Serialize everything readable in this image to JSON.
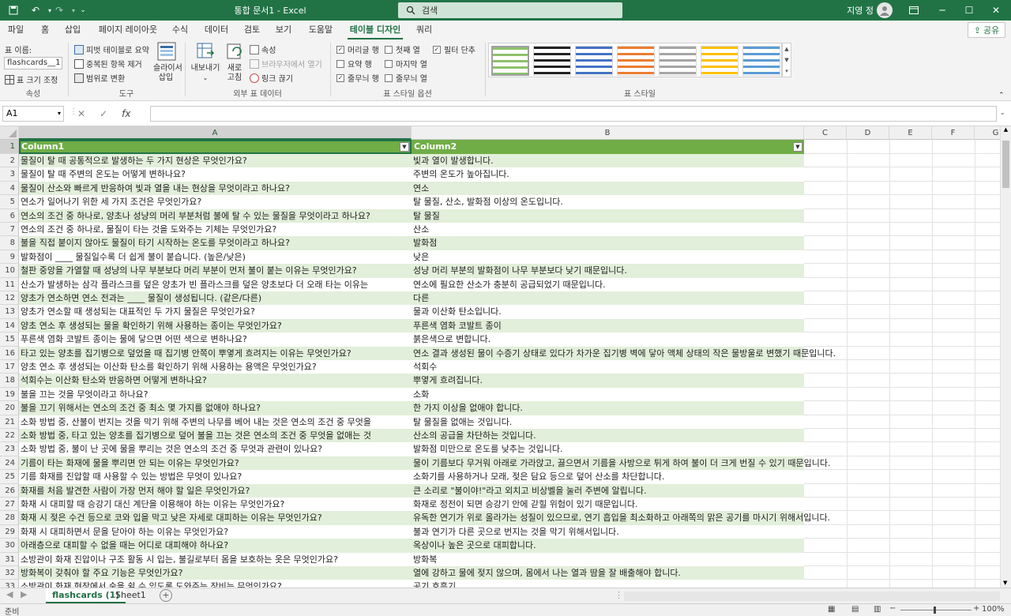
{
  "window": {
    "title": "통합 문서1  -  Excel",
    "user": "지영 정"
  },
  "search": {
    "placeholder": "검색"
  },
  "tabs": [
    {
      "label": "파일"
    },
    {
      "label": "홈"
    },
    {
      "label": "삽입"
    },
    {
      "label": "페이지 레이아웃"
    },
    {
      "label": "수식"
    },
    {
      "label": "데이터"
    },
    {
      "label": "검토"
    },
    {
      "label": "보기"
    },
    {
      "label": "도움말"
    },
    {
      "label": "테이블 디자인"
    },
    {
      "label": "쿼리"
    }
  ],
  "share_label": "공유",
  "ribbon": {
    "props": {
      "name_label": "표 이름:",
      "name_value": "flashcards__1",
      "resize": "표 크기 조정",
      "group": "속성"
    },
    "tools": {
      "pivot": "피벗 테이블로 요약",
      "dedupe": "중복된 항목 제거",
      "convert": "범위로 변환",
      "slicer": "슬라이서 삽입",
      "group": "도구"
    },
    "external": {
      "export": "내보내기",
      "refresh": "새로 고침",
      "properties": "속성",
      "open_browser": "브라우저에서 열기",
      "unlink": "링크 끊기",
      "group": "외부 표 데이터"
    },
    "options": {
      "header_row": "머리글 행",
      "total_row": "요약 행",
      "banded_rows": "줄무늬 행",
      "first_col": "첫째 열",
      "last_col": "마지막 열",
      "banded_cols": "줄무늬 열",
      "filter_btn": "필터 단추",
      "group": "표 스타일 옵션"
    },
    "styles": {
      "group": "표 스타일"
    }
  },
  "formula": {
    "cell_ref": "A1",
    "value": ""
  },
  "columns": [
    "A",
    "B",
    "C",
    "D",
    "E",
    "F",
    "G"
  ],
  "table": {
    "headers": [
      "Column1",
      "Column2"
    ],
    "rows": [
      [
        "물질이 탈 때 공통적으로 발생하는 두 가지 현상은 무엇인가요?",
        "빛과 열이 발생합니다."
      ],
      [
        "물질이 탈 때 주변의 온도는 어떻게 변하나요?",
        "주변의 온도가 높아집니다."
      ],
      [
        "물질이 산소와 빠르게 반응하여 빛과 열을 내는 현상을 무엇이라고 하나요?",
        "연소"
      ],
      [
        "연소가 일어나기 위한 세 가지 조건은 무엇인가요?",
        "탈 물질, 산소, 발화점 이상의 온도입니다."
      ],
      [
        "연소의 조건 중 하나로, 양초나 성냥의 머리 부분처럼 불에 탈 수 있는 물질을 무엇이라고 하나요?",
        "탈 물질"
      ],
      [
        "연소의 조건 중 하나로, 물질이 타는 것을 도와주는 기체는 무엇인가요?",
        "산소"
      ],
      [
        "불을 직접 붙이지 않아도 물질이 타기 시작하는 온도를 무엇이라고 하나요?",
        "발화점"
      ],
      [
        "발화점이 ____ 물질일수록 더 쉽게 불이 붙습니다. (높은/낮은)",
        "낮은"
      ],
      [
        "철판 중앙을 가열할 때 성냥의 나무 부분보다 머리 부분이 먼저 불이 붙는 이유는 무엇인가요?",
        "성냥 머리 부분의 발화점이 나무 부분보다 낮기 때문입니다."
      ],
      [
        "산소가 발생하는 삼각 플라스크를 덮은 양초가 빈 플라스크를 덮은 양초보다 더 오래 타는 이유는",
        "연소에 필요한 산소가 충분히 공급되었기 때문입니다."
      ],
      [
        "양초가 연소하면 연소 전과는 ____ 물질이 생성됩니다. (같은/다른)",
        "다른"
      ],
      [
        "양초가 연소할 때 생성되는 대표적인 두 가지 물질은 무엇인가요?",
        "물과 이산화 탄소입니다."
      ],
      [
        "양초 연소 후 생성되는 물을 확인하기 위해 사용하는 종이는 무엇인가요?",
        "푸른색 염화 코발트 종이"
      ],
      [
        "푸른색 염화 코발트 종이는 물에 닿으면 어떤 색으로 변하나요?",
        "붉은색으로 변합니다."
      ],
      [
        "타고 있는 양초를 집기병으로 덮었을 때 집기병 안쪽이 뿌옇게 흐려지는 이유는 무엇인가요?",
        "연소 결과 생성된 물이 수증기 상태로 있다가 차가운 집기병 벽에 닿아 액체 상태의 작은 물방울로 변했기 때문입니다."
      ],
      [
        "양초 연소 후 생성되는 이산화 탄소를 확인하기 위해 사용하는 용액은 무엇인가요?",
        "석회수"
      ],
      [
        "석회수는 이산화 탄소와 반응하면 어떻게 변하나요?",
        "뿌옇게 흐려집니다."
      ],
      [
        "불을 끄는 것을 무엇이라고 하나요?",
        "소화"
      ],
      [
        "불을 끄기 위해서는 연소의 조건 중 최소 몇 가지를 없애야 하나요?",
        "한 가지 이상을 없애야 합니다."
      ],
      [
        "소화 방법 중, 산불이 번지는 것을 막기 위해 주변의 나무를 베어 내는 것은 연소의 조건 중 무엇을",
        "탈 물질을 없애는 것입니다."
      ],
      [
        "소화 방법 중, 타고 있는 양초를 집기병으로 덮어 불을 끄는 것은 연소의 조건 중 무엇을 없애는 것",
        "산소의 공급을 차단하는 것입니다."
      ],
      [
        "소화 방법 중, 불이 난 곳에 물을 뿌리는 것은 연소의 조건 중 무엇과 관련이 있나요?",
        "발화점 미만으로 온도를 낮추는 것입니다."
      ],
      [
        "기름이 타는 화재에 물을 뿌리면 안 되는 이유는 무엇인가요?",
        "물이 기름보다 무거워 아래로 가라앉고, 끓으면서 기름을 사방으로 튀게 하여 불이 더 크게 번질 수 있기 때문입니다."
      ],
      [
        "기름 화재를 진압할 때 사용할 수 있는 방법은 무엇이 있나요?",
        "소화기를 사용하거나 모래, 젖은 담요 등으로 덮어 산소를 차단합니다."
      ],
      [
        "화재를 처음 발견한 사람이 가장 먼저 해야 할 일은 무엇인가요?",
        "큰 소리로 \"불이야!\"라고 외치고 비상벨을 눌러 주변에 알립니다."
      ],
      [
        "화재 시 대피할 때 승강기 대신 계단을 이용해야 하는 이유는 무엇인가요?",
        "화재로 정전이 되면 승강기 안에 갇힐 위험이 있기 때문입니다."
      ],
      [
        "화재 시 젖은 수건 등으로 코와 입을 막고 낮은 자세로 대피하는 이유는 무엇인가요?",
        "유독한 연기가 위로 올라가는 성질이 있으므로, 연기 흡입을 최소화하고 아래쪽의 맑은 공기를 마시기 위해서입니다."
      ],
      [
        "화재 시 대피하면서 문을 닫아야 하는 이유는 무엇인가요?",
        "불과 연기가 다른 곳으로 번지는 것을 막기 위해서입니다."
      ],
      [
        "아래층으로 대피할 수 없을 때는 어디로 대피해야 하나요?",
        "옥상이나 높은 곳으로 대피합니다."
      ],
      [
        "소방관이 화재 진압이나 구조 활동 시 입는, 불길로부터 몸을 보호하는 옷은 무엇인가요?",
        "방화복"
      ],
      [
        "방화복이 갖춰야 할 주요 기능은 무엇인가요?",
        "열에 강하고 물에 젖지 않으며, 몸에서 나는 열과 땀을 잘 배출해야 합니다."
      ],
      [
        "소방관이 화재 현장에서 숨을 쉴 수 있도록 도와주는 장비는 무엇인가요?",
        "공기 호흡기"
      ]
    ]
  },
  "sheets": [
    {
      "label": "flashcards (1)"
    },
    {
      "label": "Sheet1"
    }
  ],
  "status": {
    "ready": "준비",
    "zoom": "100%"
  },
  "colors": {
    "brand": "#217346",
    "table_header": "#70ad47",
    "band": "#e2efda"
  }
}
